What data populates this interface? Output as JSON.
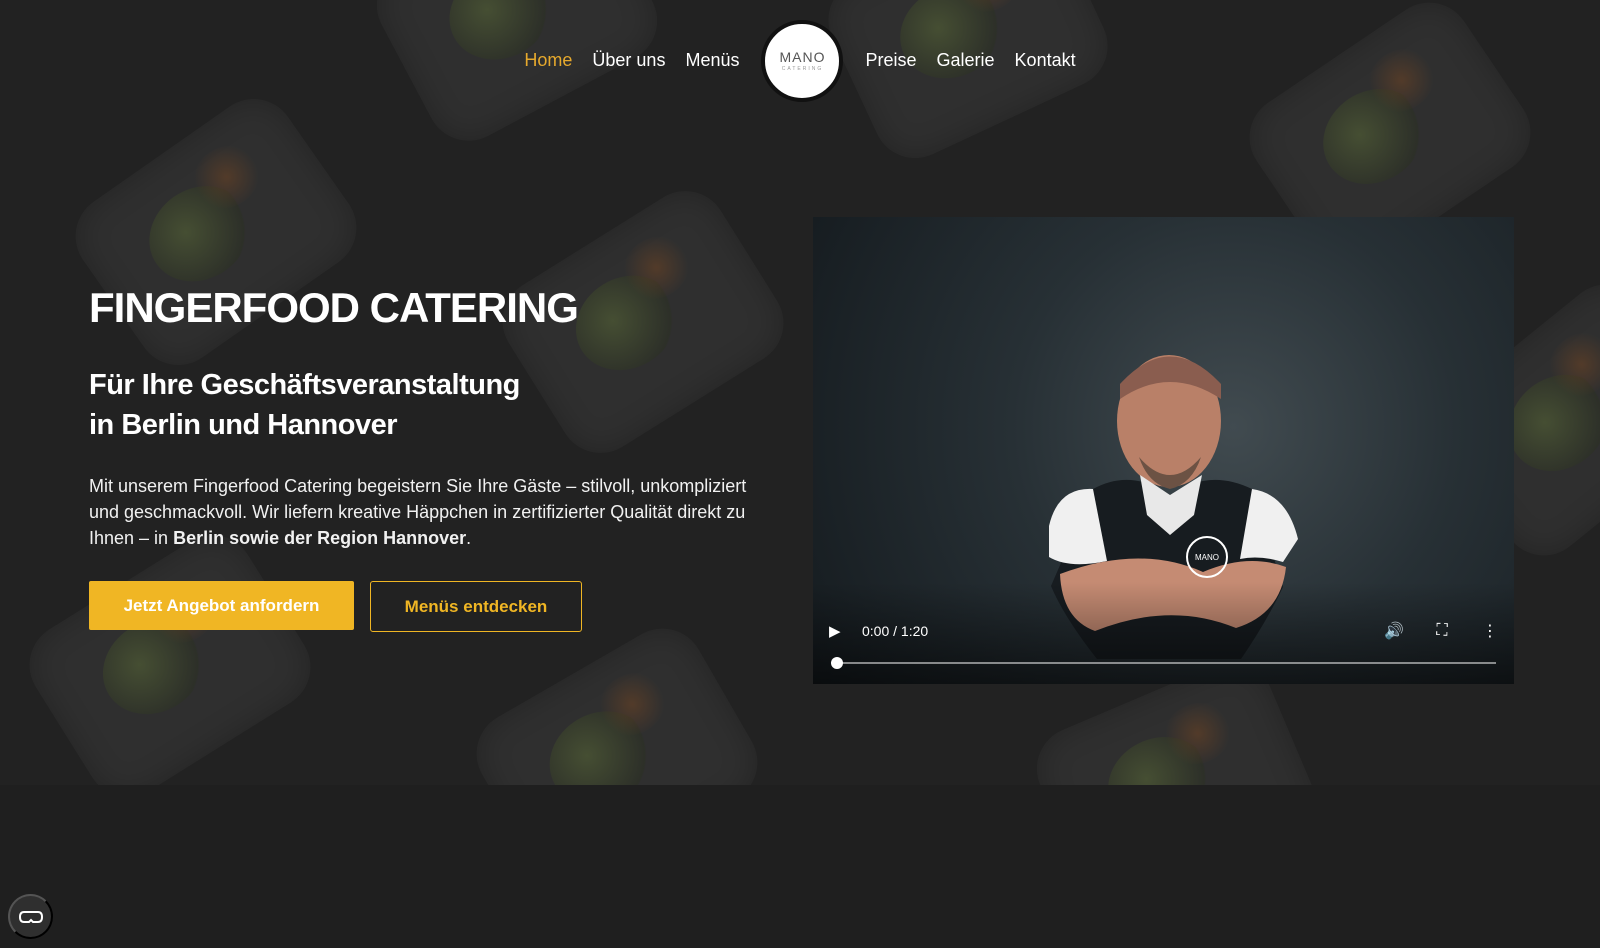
{
  "nav": {
    "left_items": [
      {
        "label": "Home",
        "active": true
      },
      {
        "label": "Über uns",
        "active": false
      },
      {
        "label": "Menüs",
        "active": false
      }
    ],
    "right_items": [
      {
        "label": "Preise",
        "active": false
      },
      {
        "label": "Galerie",
        "active": false
      },
      {
        "label": "Kontakt",
        "active": false
      }
    ],
    "logo": {
      "text": "MANO",
      "subtext": "CATERING"
    }
  },
  "hero": {
    "title": "FINGERFOOD CATERING",
    "subtitle_line1": "Für Ihre Geschäftsveranstaltung",
    "subtitle_line2": "in Berlin und Hannover",
    "copy_before_bold": "Mit unserem Fingerfood Catering begeistern Sie Ihre Gäste – stilvoll, unkompliziert und geschmackvoll. Wir liefern kreative Häppchen in zertifizierter Qualität direkt zu Ihnen – in ",
    "copy_bold": "Berlin sowie der Region Hannover",
    "copy_after_bold": ".",
    "primary_button": "Jetzt Angebot anfordern",
    "secondary_button": "Menüs entdecken"
  },
  "video": {
    "time": "0:00 / 1:20",
    "progress": 0
  },
  "colors": {
    "background": "#1f1f1f",
    "accent": "#f0b624",
    "active_nav": "#e6a92d"
  },
  "icons": {
    "play": "play-icon",
    "volume": "volume-icon",
    "fullscreen": "fullscreen-icon",
    "more": "more-vertical-icon",
    "privacy": "privacy-settings-icon"
  }
}
